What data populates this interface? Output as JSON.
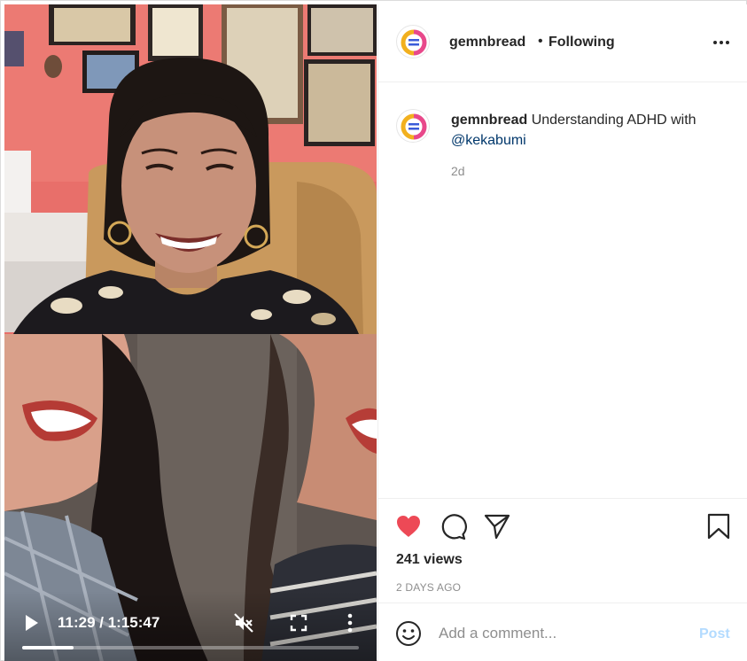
{
  "post": {
    "username": "gemnbread",
    "following_dot": "•",
    "following_label": "Following",
    "caption_text": "Understanding ADHD with",
    "caption_mention": "@kekabumi",
    "caption_time": "2d",
    "views": "241 views",
    "date": "2 DAYS AGO"
  },
  "video": {
    "time_display": "11:29 / 1:15:47",
    "progress": 0.152,
    "muted": true
  },
  "comment": {
    "placeholder": "Add a comment...",
    "post_label": "Post"
  },
  "icons": {
    "like": "heart-icon",
    "comment": "comment-icon",
    "share": "paper-plane-icon",
    "save": "bookmark-icon",
    "emoji": "smiley-icon",
    "options": "more-options-icon"
  },
  "colors": {
    "like_active": "#ed4956",
    "mention": "#00376b",
    "post_button_disabled": "#b3dbff",
    "secondary_text": "#8e8e8e"
  }
}
